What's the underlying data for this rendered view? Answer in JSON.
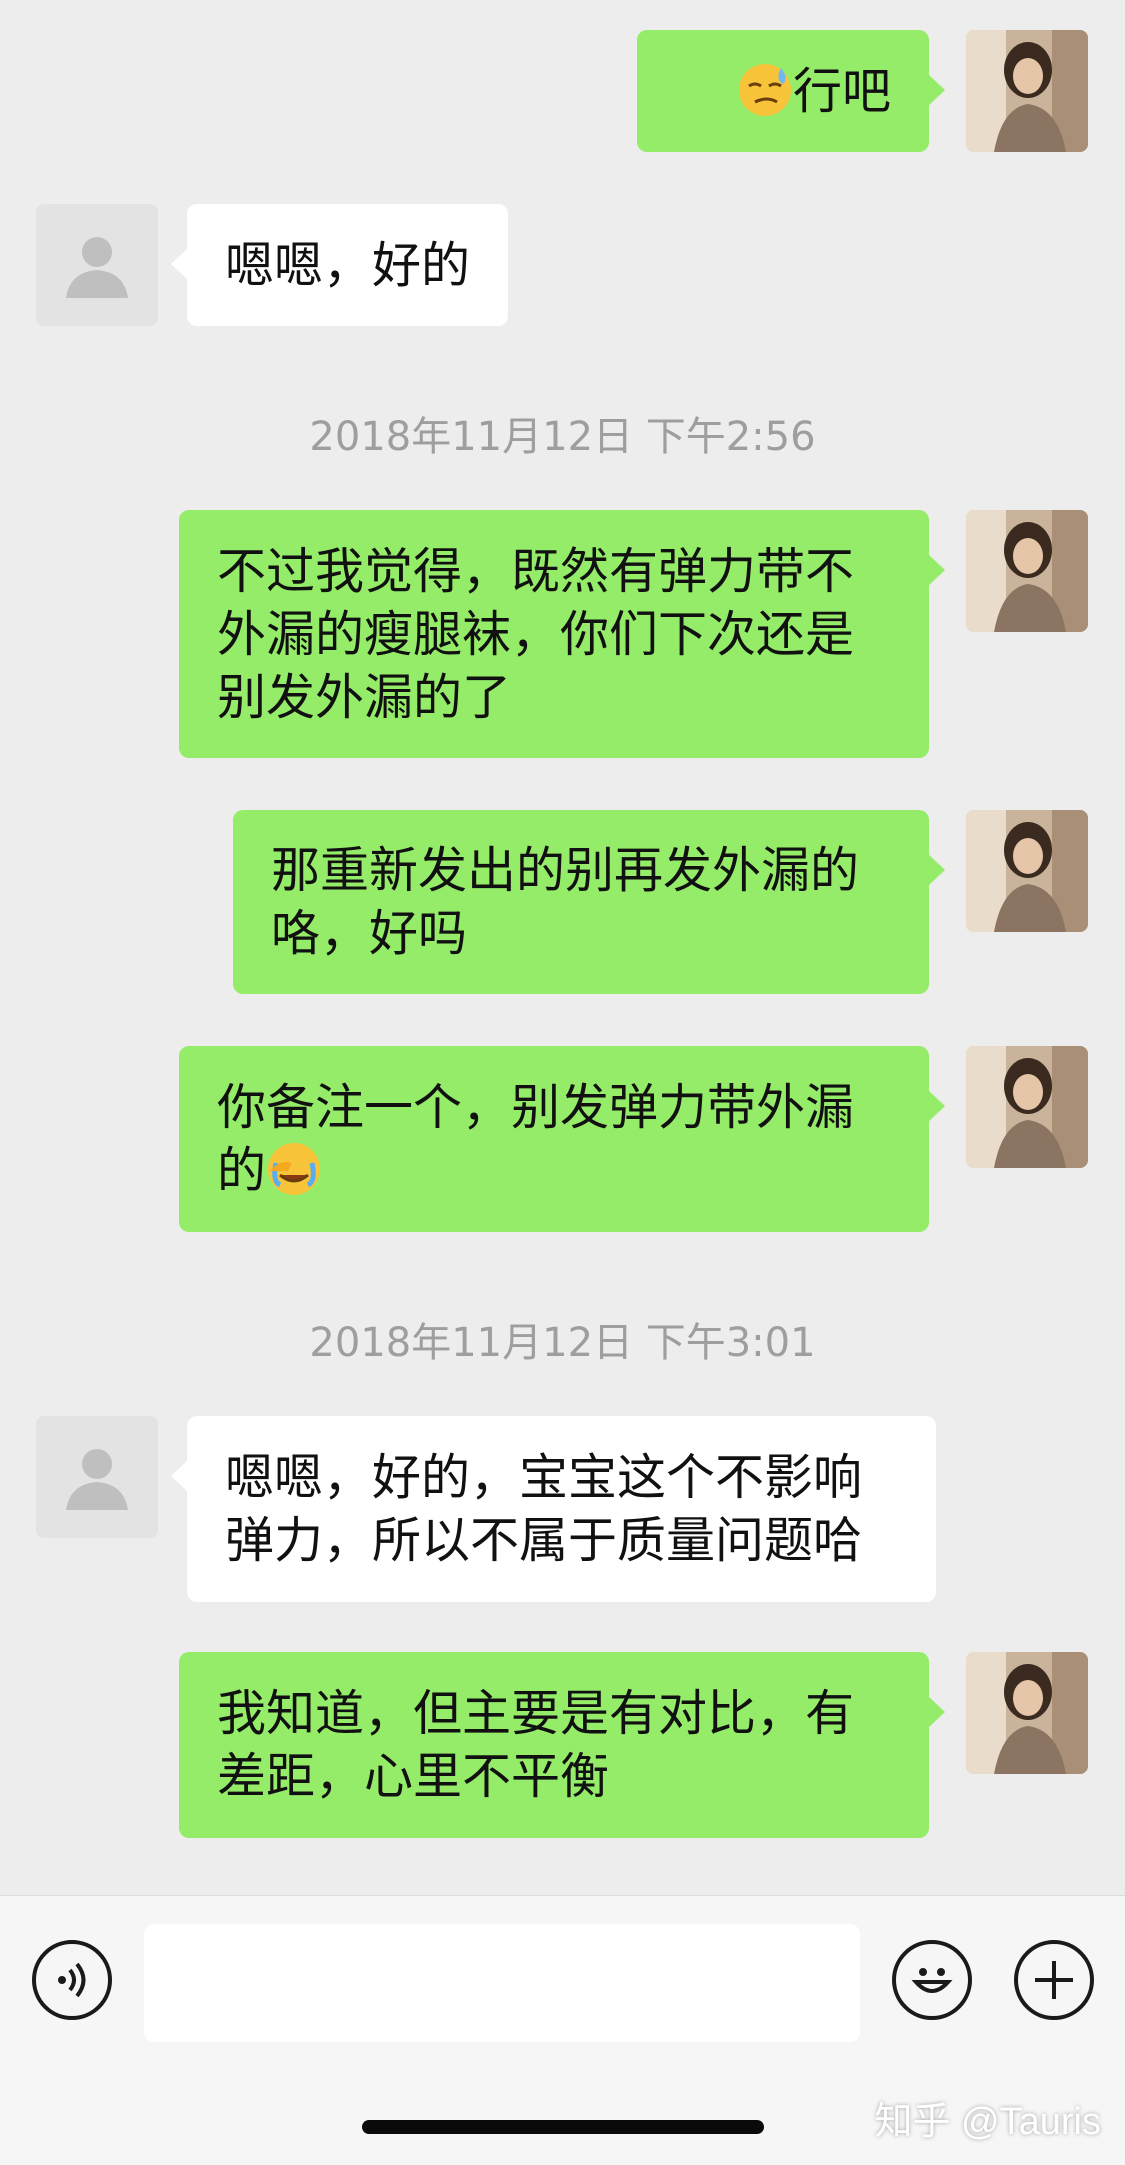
{
  "messages": [
    {
      "side": "me",
      "text": "行吧",
      "emoji_before": "smirk-sweat-emoji"
    },
    {
      "side": "other",
      "text": "嗯嗯，好的"
    },
    {
      "timestamp": "2018年11月12日 下午2:56"
    },
    {
      "side": "me",
      "text": "不过我觉得，既然有弹力带不\n外漏的瘦腿袜，你们下次还是\n别发外漏的了"
    },
    {
      "side": "me",
      "text": "那重新发出的别再发外漏的\n咯，好吗"
    },
    {
      "side": "me",
      "text": "你备注一个，别发弹力带外漏\n的",
      "emoji_after": "facepalm-cry-emoji"
    },
    {
      "timestamp": "2018年11月12日 下午3:01"
    },
    {
      "side": "other",
      "text": "嗯嗯，好的，宝宝这个不影响\n弹力，所以不属于质量问题哈"
    },
    {
      "side": "me",
      "text": "我知道，但主要是有对比，有\n差距，心里不平衡"
    }
  ],
  "input_bar": {
    "left_icon": "voice-icon",
    "right_icons": [
      "emoji-icon",
      "plus-icon"
    ],
    "input_value": ""
  },
  "watermark": "知乎 @Tauris",
  "colors": {
    "background": "#ededed",
    "my_bubble": "#95ec69",
    "their_bubble": "#ffffff",
    "timestamp": "#9e9e9e"
  }
}
